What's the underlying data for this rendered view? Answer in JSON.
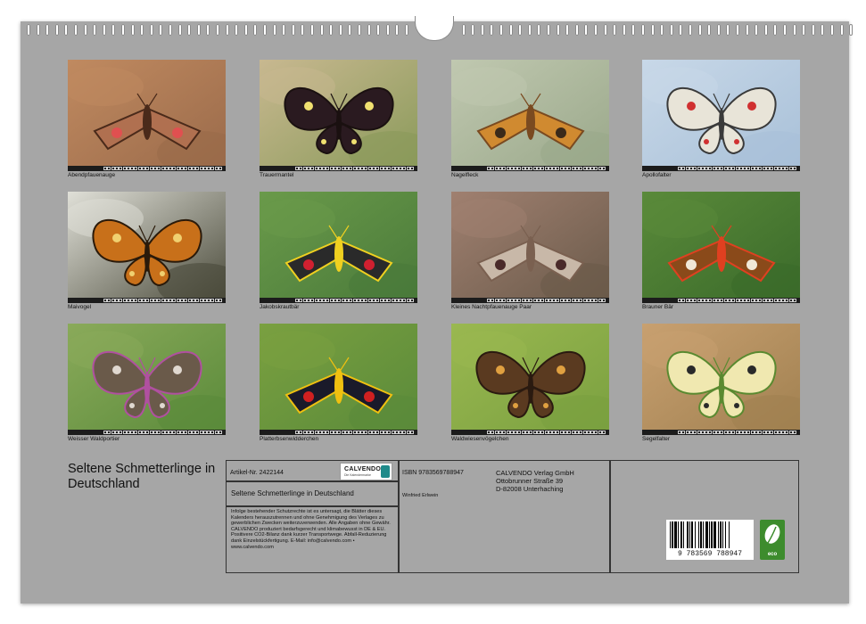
{
  "photos": [
    {
      "caption": "Abendpfauenauge",
      "icon": "hawkmoth-eyed",
      "bg": "#9a6a4a",
      "bg2": "#c08a60",
      "wing": "#b07050",
      "accent": "#e05050",
      "dark": "#4a2a1a"
    },
    {
      "caption": "Trauermantel",
      "icon": "butterfly-mourning-cloak",
      "bg": "#8a9a5a",
      "bg2": "#c8b890",
      "wing": "#2a1a20",
      "accent": "#f0e070",
      "dark": "#1a1010"
    },
    {
      "caption": "Nagelfleck",
      "icon": "moth-tau-emperor",
      "bg": "#9aa88a",
      "bg2": "#c0c8b0",
      "wing": "#d08a30",
      "accent": "#3a2a1a",
      "dark": "#7a4a20"
    },
    {
      "caption": "Apollofalter",
      "icon": "butterfly-apollo",
      "bg": "#a8c0d8",
      "bg2": "#c8d8e8",
      "wing": "#e8e4d8",
      "accent": "#d03030",
      "dark": "#3a3a3a"
    },
    {
      "caption": "Maivogel",
      "icon": "butterfly-scarce-fritillary",
      "bg": "#4a4a3a",
      "bg2": "#e0e0d8",
      "wing": "#c8701a",
      "accent": "#f0d070",
      "dark": "#2a1a0a"
    },
    {
      "caption": "Jakobskrautbär",
      "icon": "moth-cinnabar",
      "bg": "#4a7a3a",
      "bg2": "#6a9a4a",
      "wing": "#2a2a2a",
      "accent": "#d02030",
      "dark": "#f0d020"
    },
    {
      "caption": "Kleines Nachtpfauenauge Paar",
      "icon": "moth-emperor-pair",
      "bg": "#6a5a4a",
      "bg2": "#a08070",
      "wing": "#c8b8a8",
      "accent": "#4a2a2a",
      "dark": "#7a6050"
    },
    {
      "caption": "Brauner Bär",
      "icon": "moth-garden-tiger",
      "bg": "#3a6a2a",
      "bg2": "#5a8a3a",
      "wing": "#8a4a1a",
      "accent": "#f0e8d8",
      "dark": "#e04020"
    },
    {
      "caption": "Weisser Waldportier",
      "icon": "butterfly-great-banded-grayling",
      "bg": "#5a8a3a",
      "bg2": "#8aaa5a",
      "wing": "#6a5a4a",
      "accent": "#e0d8d0",
      "dark": "#b050a0"
    },
    {
      "caption": "Platterbsenwidderchen",
      "icon": "moth-burnet",
      "bg": "#5a8a3a",
      "bg2": "#7aa040",
      "wing": "#1a1a2a",
      "accent": "#d02020",
      "dark": "#f0c010"
    },
    {
      "caption": "Waldwiesenvögelchen",
      "icon": "butterfly-heath",
      "bg": "#7aa040",
      "bg2": "#9ab850",
      "wing": "#5a3a20",
      "accent": "#e0a040",
      "dark": "#2a1a10"
    },
    {
      "caption": "Segelfalter",
      "icon": "butterfly-scarce-swallowtail",
      "bg": "#a08050",
      "bg2": "#c8a070",
      "wing": "#f0e8b0",
      "accent": "#2a2a2a",
      "dark": "#5a8a30"
    }
  ],
  "cover_title": "Seltene Schmetterlinge in Deutschland",
  "info": {
    "article_number": "Artikel-Nr. 2422144",
    "product_title": "Seltene Schmetterlinge in Deutschland",
    "legal_text": "Infolge bestehender Schutzrechte ist es untersagt, die Blätter dieses Kalenders herauszutrennen und ohne Genehmigung des Verlages zu gewerblichen Zwecken weiterzuverwenden. Alle Angaben ohne Gewähr. CALVENDO produziert bedarfsgerecht und klimabewusst in DE & EU. Positivere CO2-Bilanz dank kurzer Transportwege. Abfall-Reduzierung dank Einzelstückfertigung. E-Mail: info@calvendo.com • www.calvendo.com",
    "isbn": "ISBN 9783569788947",
    "author": "Winfried Erlwein",
    "publisher_name": "CALVENDO Verlag GmbH",
    "publisher_street": "Ottobrunner Straße 39",
    "publisher_city": "D-82008 Unterhaching",
    "barcode_number": "9 783569 788947",
    "logo_name": "CALVENDO",
    "logo_sub": "Die Kalendermarke",
    "eco_label": "eco"
  }
}
